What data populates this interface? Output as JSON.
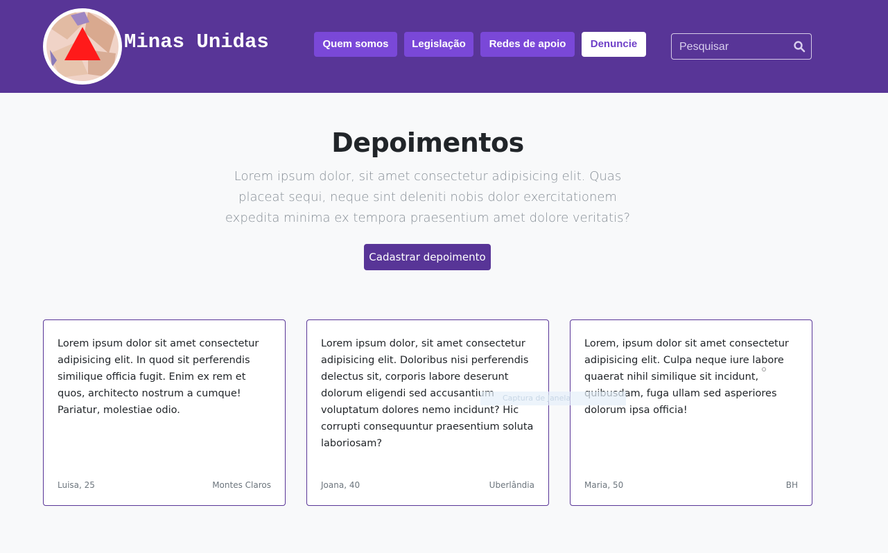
{
  "header": {
    "brand": "Minas Unidas",
    "nav": [
      {
        "label": "Quem somos"
      },
      {
        "label": "Legislação"
      },
      {
        "label": "Redes de apoio"
      },
      {
        "label": "Denuncie"
      }
    ],
    "search": {
      "placeholder": "Pesquisar"
    }
  },
  "main": {
    "title": "Depoimentos",
    "lead": "Lorem ipsum dolor, sit amet consectetur adipisicing elit. Quas placeat sequi, neque sint deleniti nobis dolor exercitationem expedita minima ex tempora praesentium amet dolore veritatis?",
    "cta_label": "Cadastrar depoimento"
  },
  "cards": [
    {
      "text": "Lorem ipsum dolor sit amet consectetur adipisicing elit. In quod sit perferendis similique officia fugit. Enim ex rem et quos, architecto nostrum a cumque! Pariatur, molestiae odio.",
      "author": "Luisa, 25",
      "city": "Montes Claros"
    },
    {
      "text": "Lorem ipsum dolor, sit amet consectetur adipisicing elit. Doloribus nisi perferendis delectus sit, corporis labore deserunt dolorum eligendi sed accusantium voluptatum dolores nemo incidunt? Hic corrupti consequuntur praesentium soluta laboriosam?",
      "author": "Joana, 40",
      "city": "Uberlândia"
    },
    {
      "text": "Lorem, ipsum dolor sit amet consectetur adipisicing elit. Culpa neque iure labore quaerat nihil similique sit incidunt, quibusdam, fuga ullam sed asperiores dolorum ipsa officia!",
      "author": "Maria, 50",
      "city": "BH"
    }
  ],
  "overlay": {
    "tooltip_text": "Captura de Janela"
  },
  "colors": {
    "brand_purple": "#583597",
    "button_purple": "#7a48d8",
    "logo_triangle": "#ff1a1a"
  },
  "icons": {
    "search": "search-icon",
    "logo": "hands-triangle-logo"
  }
}
